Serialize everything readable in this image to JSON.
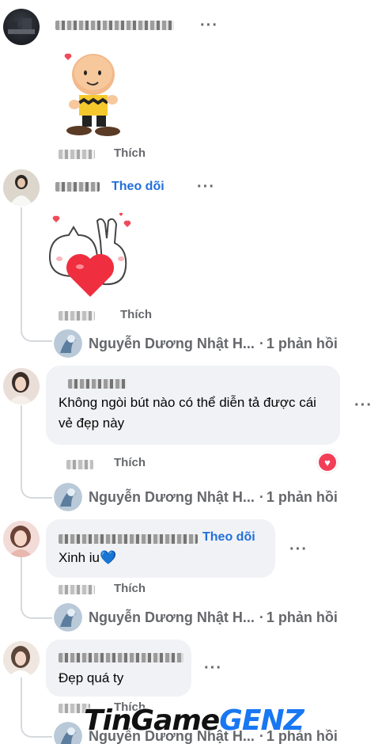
{
  "labels": {
    "like": "Thích",
    "follow": "Theo dõi",
    "more": "···"
  },
  "replies": {
    "author": "Nguyễn Dương Nhật H...",
    "separator": "·",
    "count": "1 phản hồi"
  },
  "comments": [
    {
      "text": ""
    },
    {
      "text": ""
    },
    {
      "text": "Không ngòi bút nào có thể diễn tả được cái vẻ đẹp này"
    },
    {
      "text": "Xinh iu💙"
    },
    {
      "text": "Đẹp quá ty"
    }
  ],
  "watermark": {
    "part1": "TinGame",
    "part2": "GENZ"
  },
  "colors": {
    "link": "#216fdb",
    "muted": "#65676b",
    "bubble": "#f0f2f5",
    "heart": "#f33e58"
  }
}
